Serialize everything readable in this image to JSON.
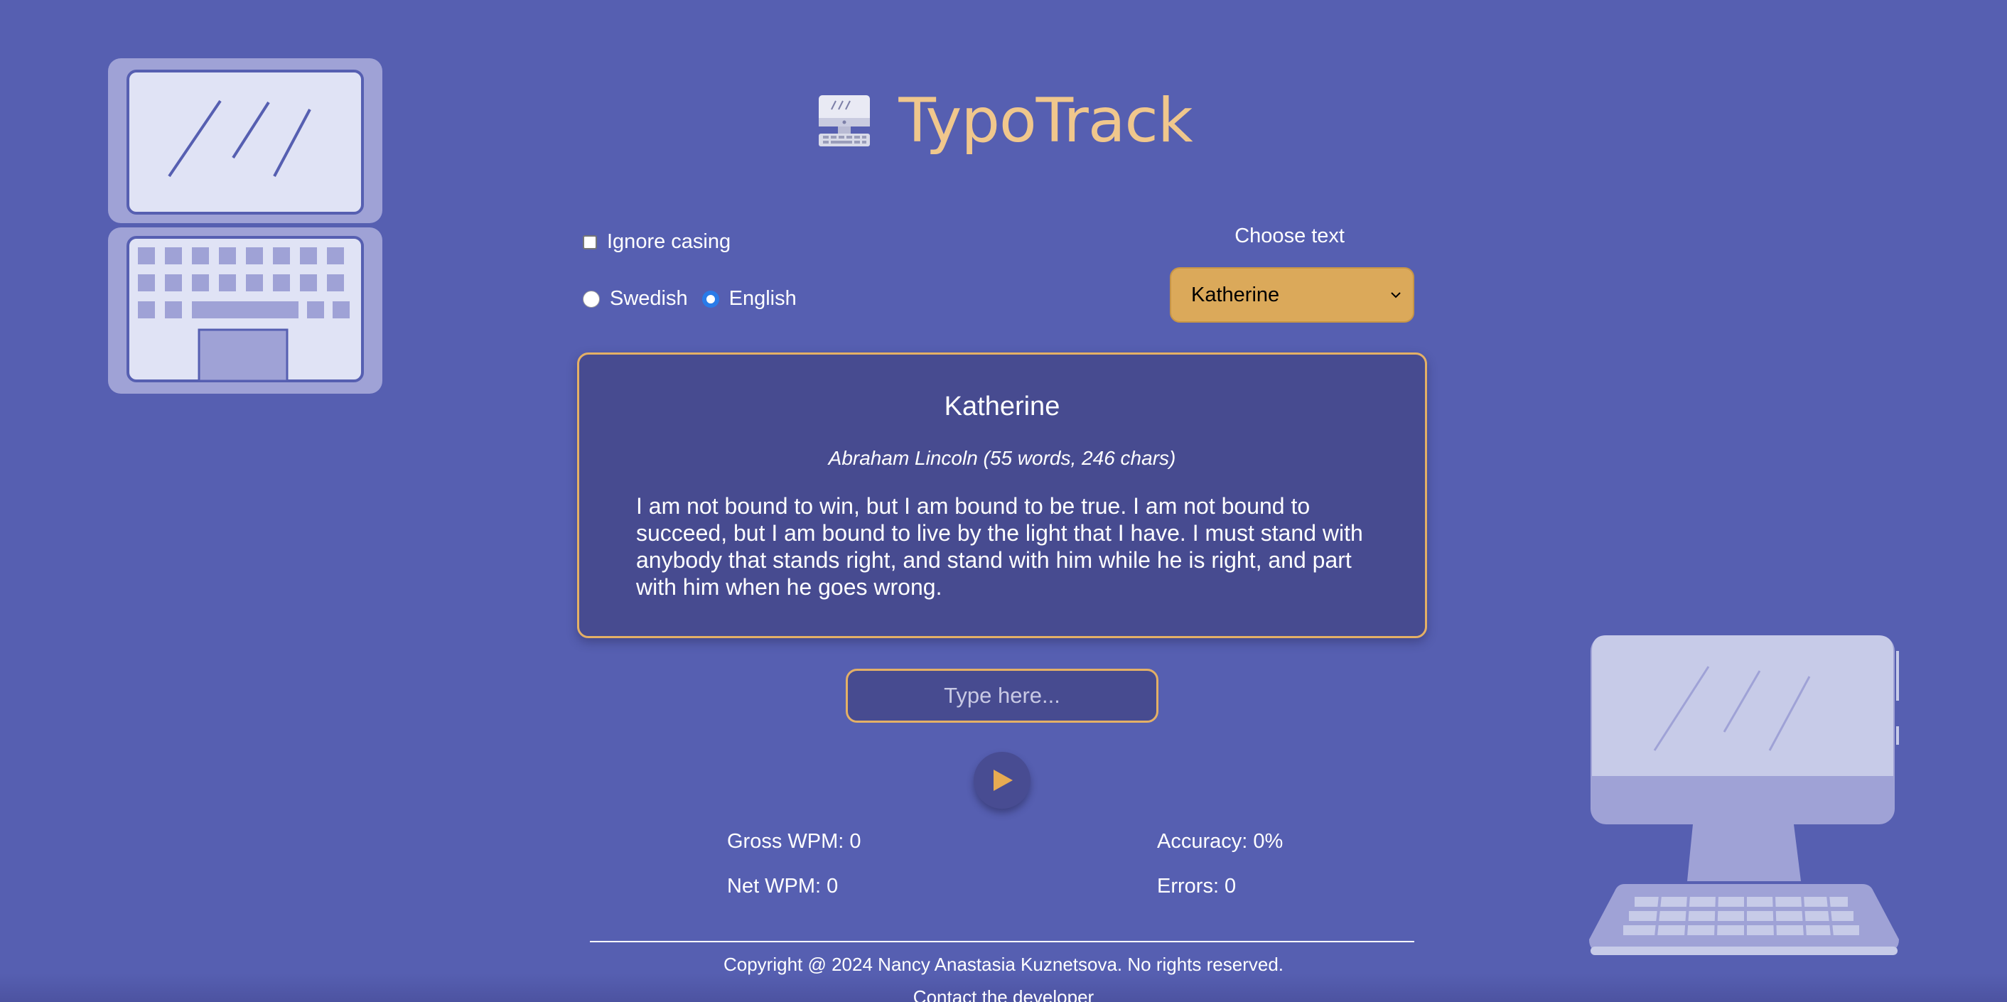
{
  "app": {
    "title": "TypoTrack",
    "logo_icon": "desktop-computer-icon"
  },
  "controls": {
    "ignore_casing_label": "Ignore casing",
    "ignore_casing_checked": false,
    "languages": [
      "Swedish",
      "English"
    ],
    "selected_language": "English",
    "choose_text_label": "Choose text",
    "selected_text": "Katherine"
  },
  "card": {
    "title": "Katherine",
    "meta": "Abraham Lincoln (55 words, 246 chars)",
    "text": "I am not bound to win, but I am bound to be true. I am not bound to succeed, but I am bound to live by the light that I have. I must stand with anybody that stands right, and stand with him while he is right, and part with him when he goes wrong."
  },
  "input": {
    "placeholder": "Type here..."
  },
  "stats": {
    "gross_wpm": "Gross WPM: 0",
    "net_wpm": "Net WPM: 0",
    "accuracy": "Accuracy: 0%",
    "errors": "Errors: 0"
  },
  "footer": {
    "copyright": "Copyright @ 2024 Nancy Anastasia Kuznetsova. No rights reserved.",
    "contact": "Contact the developer"
  },
  "colors": {
    "background": "#565fb1",
    "accent": "#f0c78c",
    "card": "#474b90",
    "border": "#e4b066",
    "select": "#dba95a"
  },
  "icons": {
    "play": "play-icon",
    "select_chevron": "chevron-down-icon",
    "decor_left": "laptop-illustration",
    "decor_right": "desktop-illustration"
  }
}
